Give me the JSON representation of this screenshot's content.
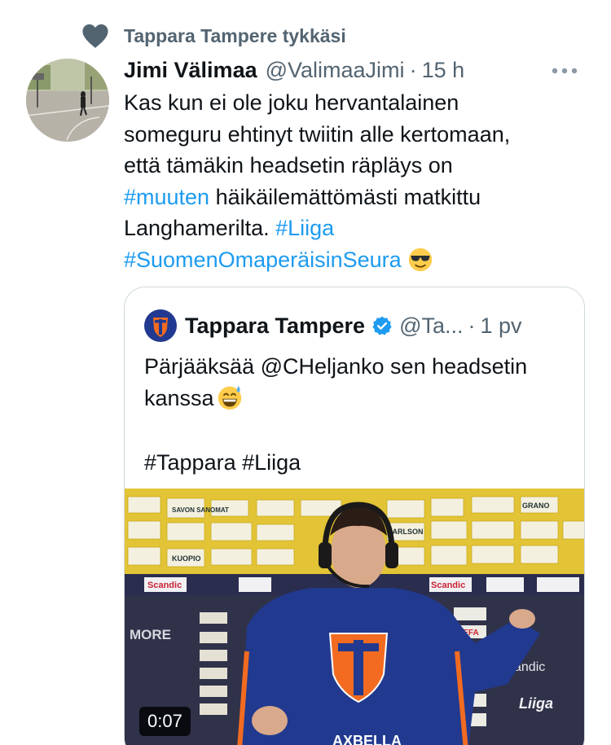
{
  "social_context": {
    "text": "Tappara Tampere tykkäsi",
    "icon": "heart-icon"
  },
  "tweet": {
    "author_name": "Jimi Välimaa",
    "author_handle": "@ValimaaJimi",
    "separator": "·",
    "timestamp": "15 h",
    "text_lines": [
      "Kas kun ei ole joku hervantalainen",
      "someguru ehtinyt twiitin alle kertomaan,",
      "että tämäkin headsetin räpläys on"
    ],
    "hashtag_muuten": "#muuten",
    "line4_rest": " häikäilemättömästi matkittu",
    "line5_text": "Langhamerilta. ",
    "hashtag_liiga": "#Liiga",
    "hashtag_seura": "#SuomenOmaperäisinSeura",
    "emoji": "smiling-face-with-sunglasses"
  },
  "quote": {
    "author_name": "Tappara Tampere",
    "author_handle": "@Ta...",
    "separator": "·",
    "timestamp": "1 pv",
    "body_line1": "Pärjääksää @CHeljanko sen headsetin",
    "body_line2": "kanssa",
    "emoji": "grinning-face-with-sweat",
    "hashtags": "#Tappara #Liiga",
    "video": {
      "duration": "0:07",
      "sponsor_text": [
        "SAVON SANOMAT",
        "CARLSON",
        "GRANO",
        "KUOPIO",
        "Scandic",
        "MORE",
        "DEFA",
        "Liiga",
        "AXBELLA"
      ]
    }
  },
  "colors": {
    "link": "#1d9bf0",
    "secondary": "#536471",
    "border": "#cfd9de",
    "jersey": "#213a8f",
    "logo_orange": "#f26b21"
  }
}
